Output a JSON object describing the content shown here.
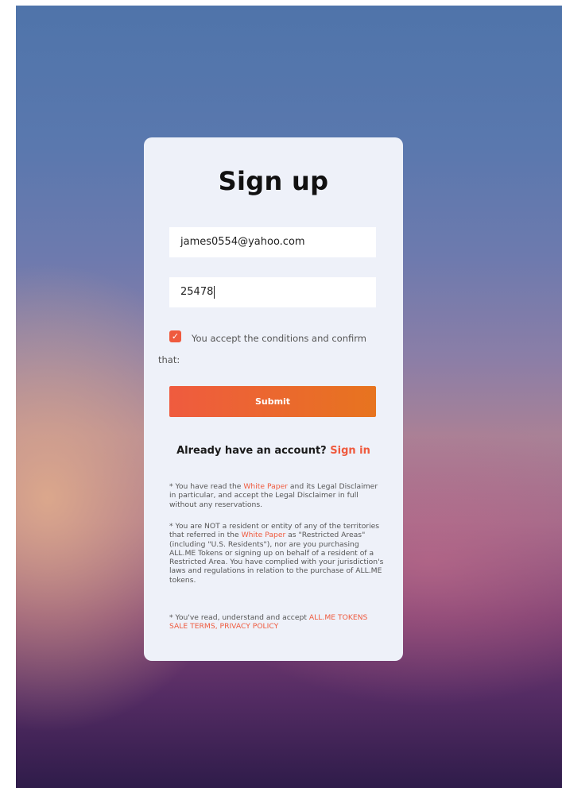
{
  "form": {
    "title": "Sign up",
    "email_value": "james0554@yahoo.com",
    "code_value": "25478",
    "checkbox_checked": true,
    "accept_text": "You accept the conditions and confirm that:",
    "submit_label": "Submit"
  },
  "signin": {
    "prompt": "Already have an account?",
    "link_label": "Sign in"
  },
  "legal": {
    "item1_prefix": "* You have read the",
    "item1_link": "White Paper",
    "item1_suffix": "and its Legal Disclaimer in particular, and accept the Legal Disclaimer in full without any reservations.",
    "item2_prefix": "* You are NOT a resident or entity of any of the territories that referred in the",
    "item2_link": "White Paper",
    "item2_suffix": "as \"Restricted Areas\" (including \"U.S. Residents\"), nor are you purchasing ALL.ME Tokens or signing up on behalf of a resident of a Restricted Area. You have complied with your jurisdiction's laws and regulations in relation to the purchase of ALL.ME tokens.",
    "item3_prefix": "* You've read, understand and accept",
    "item3_link1": "ALL.ME TOKENS SALE TERMS,",
    "item3_link2": "PRIVACY POLICY"
  },
  "colors": {
    "accent": "#ef5a3e",
    "button_gradient_start": "#ef5b3f",
    "button_gradient_end": "#e7741f",
    "card_background": "#eef1f9"
  },
  "icons": {
    "checkbox": "check-icon"
  }
}
